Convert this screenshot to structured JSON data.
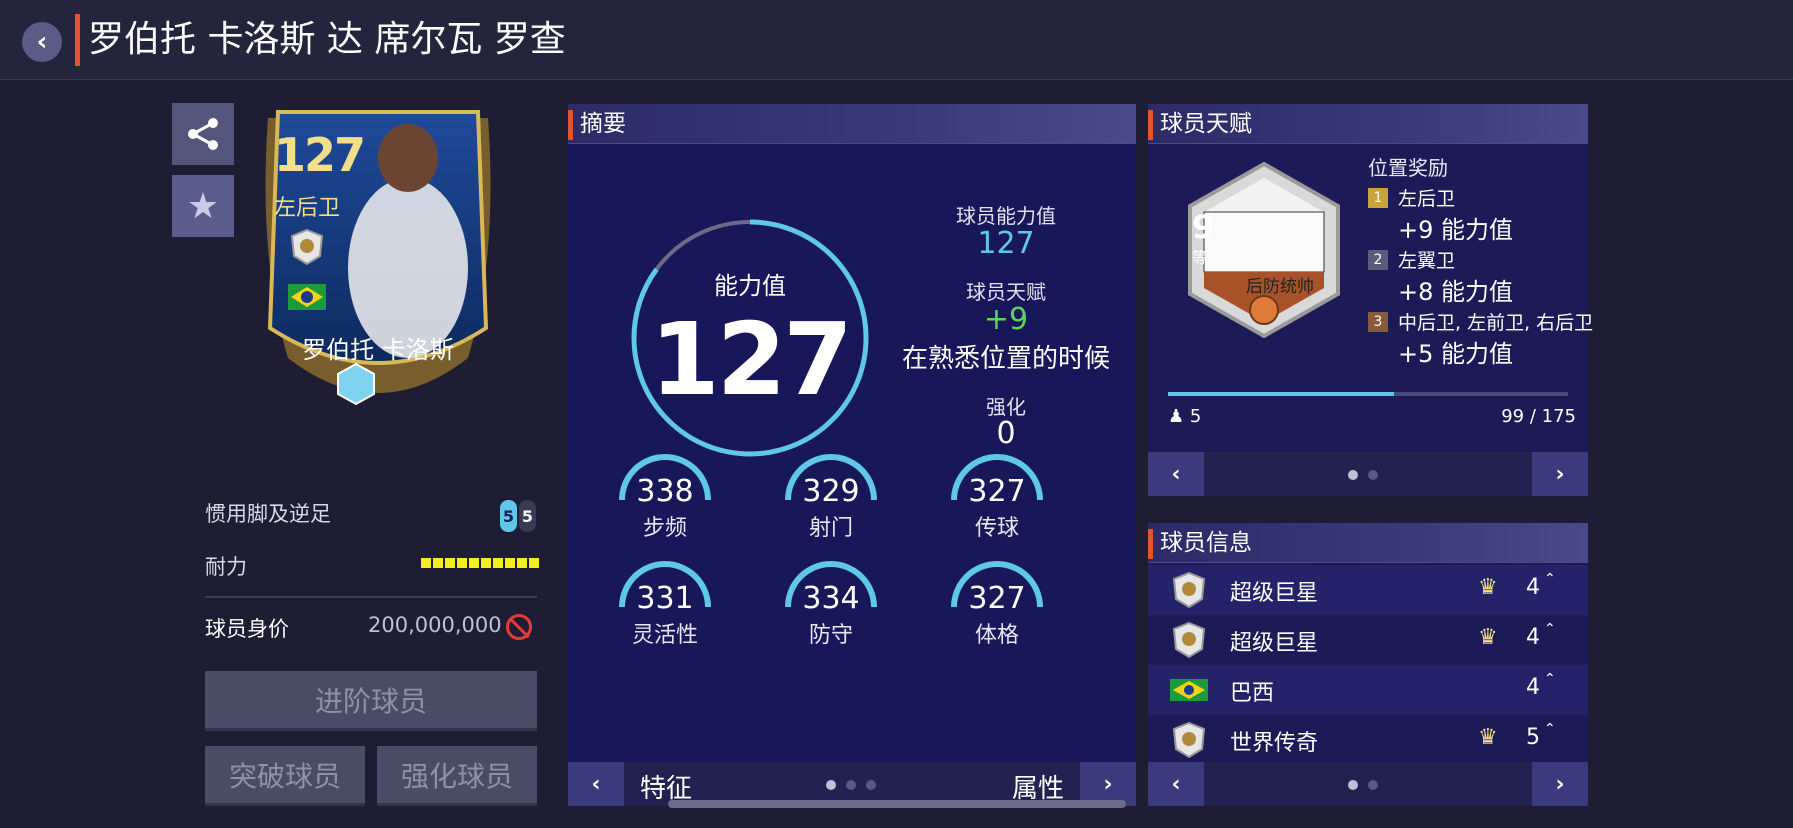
{
  "header": {
    "title": "罗伯托 卡洛斯 达 席尔瓦 罗查"
  },
  "card": {
    "rating": "127",
    "position": "左后卫",
    "name": "罗伯托 卡洛斯"
  },
  "left": {
    "foot_label": "惯用脚及逆足",
    "weak_foot_left": "5",
    "weak_foot_right": "5",
    "stamina_label": "耐力",
    "stamina_segments": 10,
    "value_label": "球员身价",
    "value": "200,000,000",
    "btn_advance": "进阶球员",
    "btn_breakthrough": "突破球员",
    "btn_enhance": "强化球员"
  },
  "summary": {
    "title": "摘要",
    "ring_label": "能力值",
    "ring_value": "127",
    "ovr_label": "球员能力值",
    "ovr_value": "127",
    "talent_label": "球员天赋",
    "talent_value": "+9",
    "talent_note": "在熟悉位置的时候",
    "enhance_label": "强化",
    "enhance_value": "0",
    "attributes": [
      {
        "value": "338",
        "label": "步频"
      },
      {
        "value": "329",
        "label": "射门"
      },
      {
        "value": "327",
        "label": "传球"
      },
      {
        "value": "331",
        "label": "灵活性"
      },
      {
        "value": "334",
        "label": "防守"
      },
      {
        "value": "327",
        "label": "体格"
      }
    ],
    "footer_left": "特征",
    "footer_right": "属性",
    "prev": "‹",
    "next": "›"
  },
  "traits": {
    "title": "球员天赋",
    "tier": "9",
    "tier_label": "等级",
    "trait_name": "后防统帅",
    "bonus_title": "位置奖励",
    "bonuses": [
      {
        "num": "1",
        "position": "左后卫",
        "value": "+9 能力值",
        "color": "#c9a23a"
      },
      {
        "num": "2",
        "position": "左翼卫",
        "value": "+8 能力值",
        "color": "#5a5c7a"
      },
      {
        "num": "3",
        "position": "中后卫, 左前卫, 右后卫",
        "value": "+5 能力值",
        "color": "#8a5a3a"
      }
    ],
    "people": "5",
    "progress_text": "99 / 175",
    "progress_fraction": 0.566
  },
  "player_info": {
    "title": "球员信息",
    "rows": [
      {
        "label": "超级巨星",
        "count": "4",
        "crown": true,
        "icon": "icon-badge"
      },
      {
        "label": "超级巨星",
        "count": "4",
        "crown": true,
        "icon": "icon-badge"
      },
      {
        "label": "巴西",
        "count": "4",
        "crown": false,
        "icon": "brazil-flag"
      },
      {
        "label": "世界传奇",
        "count": "5",
        "crown": true,
        "icon": "icon-badge"
      }
    ]
  },
  "colors": {
    "accent": "#e2542e",
    "ring": "#5fc8e8",
    "talent": "#5bd65b",
    "stamina": "#f2ee1f"
  }
}
